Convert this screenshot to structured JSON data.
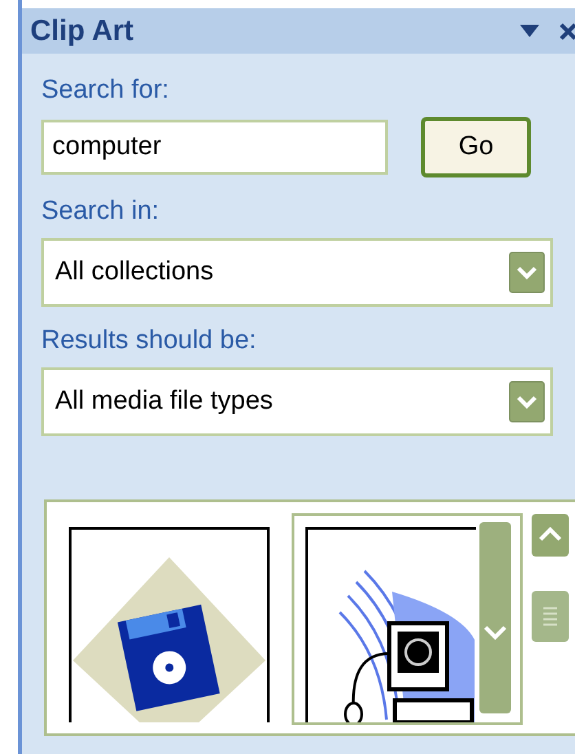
{
  "pane": {
    "title": "Clip Art"
  },
  "search": {
    "label": "Search for:",
    "value": "computer",
    "button": "Go"
  },
  "search_in": {
    "label": "Search in:",
    "value": "All collections"
  },
  "results_type": {
    "label": "Results should be:",
    "value": "All media file types"
  },
  "results": [
    {
      "kind": "floppy",
      "selected": false
    },
    {
      "kind": "computer",
      "selected": true
    }
  ]
}
